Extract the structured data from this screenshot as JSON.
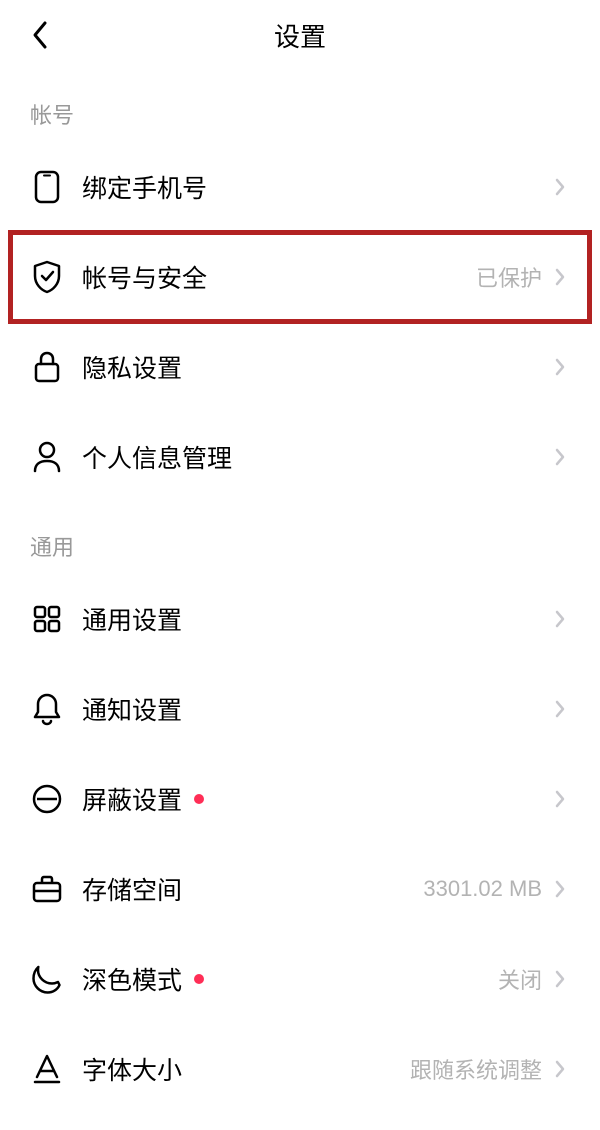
{
  "header": {
    "title": "设置"
  },
  "sections": {
    "account": {
      "header": "帐号",
      "items": {
        "bind_phone": {
          "label": "绑定手机号",
          "value": ""
        },
        "account_security": {
          "label": "帐号与安全",
          "value": "已保护"
        },
        "privacy": {
          "label": "隐私设置",
          "value": ""
        },
        "personal_info": {
          "label": "个人信息管理",
          "value": ""
        }
      }
    },
    "general": {
      "header": "通用",
      "items": {
        "general_settings": {
          "label": "通用设置",
          "value": ""
        },
        "notification": {
          "label": "通知设置",
          "value": ""
        },
        "block": {
          "label": "屏蔽设置",
          "value": ""
        },
        "storage": {
          "label": "存储空间",
          "value": "3301.02 MB"
        },
        "dark_mode": {
          "label": "深色模式",
          "value": "关闭"
        },
        "font_size": {
          "label": "字体大小",
          "value": "跟随系统调整"
        }
      }
    }
  }
}
